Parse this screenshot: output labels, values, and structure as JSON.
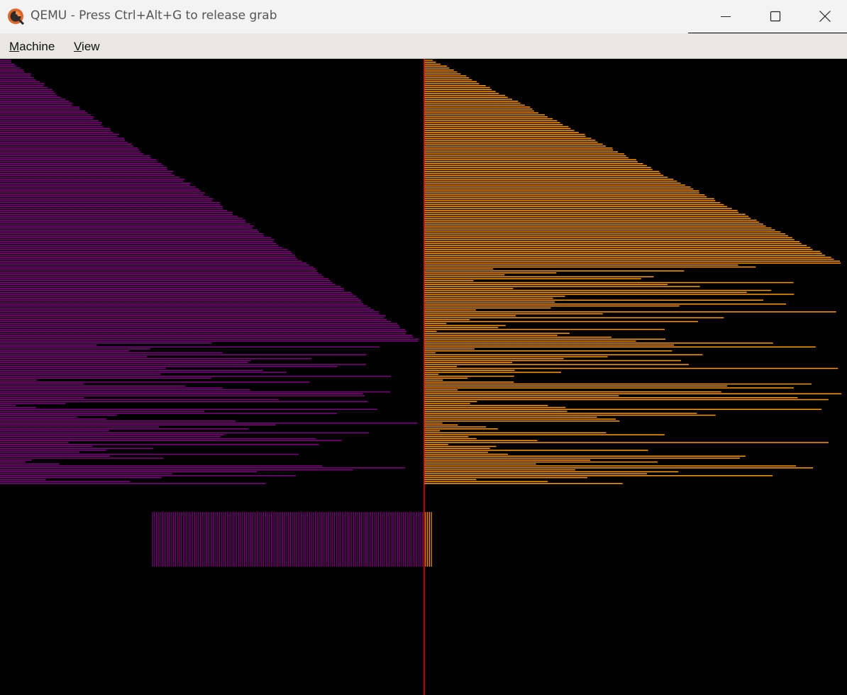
{
  "window": {
    "title": "QEMU - Press Ctrl+Alt+G to release grab",
    "icon": "qemu-logo-icon",
    "controls": [
      "minimize-icon",
      "maximize-icon",
      "close-icon"
    ]
  },
  "menubar": {
    "items": [
      {
        "mnemonic": "M",
        "rest": "achine"
      },
      {
        "mnemonic": "V",
        "rest": "iew"
      }
    ]
  },
  "colors": {
    "titlebar_bg": "#f3f3f3",
    "menubar_bg": "#e8e7e3",
    "screen_bg": "#000000",
    "left_bars": "#800080",
    "right_bars": "#ff9a00",
    "divider": "#ff0000"
  }
}
